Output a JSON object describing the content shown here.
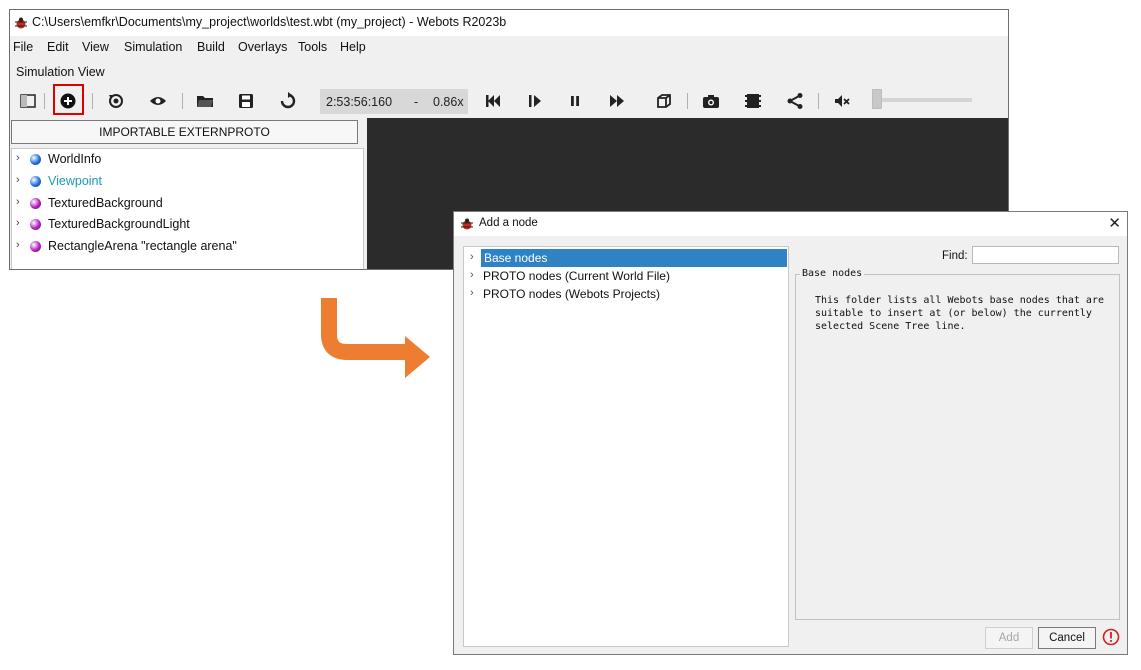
{
  "main_window": {
    "title": "C:\\Users\\emfkr\\Documents\\my_project\\worlds\\test.wbt (my_project) - Webots R2023b",
    "menu": [
      "File",
      "Edit",
      "View",
      "Simulation",
      "Build",
      "Overlays",
      "Tools",
      "Help"
    ],
    "view_label": "Simulation View",
    "toolbar": {
      "icons": [
        "panel-toggle-icon",
        "add-node-icon",
        "reset-view-icon",
        "eye-icon",
        "open-folder-icon",
        "save-icon",
        "reload-icon",
        "step-back-icon",
        "step-forward-icon",
        "pause-icon",
        "fast-forward-icon",
        "cube-icon",
        "camera-icon",
        "film-icon",
        "share-icon",
        "mute-icon"
      ],
      "time": "2:53:56:160",
      "dash": "-",
      "speed": "0.86x"
    },
    "extern_button": "IMPORTABLE EXTERNPROTO",
    "scene_tree": [
      {
        "label": "WorldInfo",
        "color": "#1f6fe0",
        "text_color": "#111111"
      },
      {
        "label": "Viewpoint",
        "color": "#1f6fe0",
        "text_color": "#1a9bb5"
      },
      {
        "label": "TexturedBackground",
        "color": "#b21fbf",
        "text_color": "#111111"
      },
      {
        "label": "TexturedBackgroundLight",
        "color": "#b21fbf",
        "text_color": "#111111"
      },
      {
        "label": "RectangleArena \"rectangle arena\"",
        "color": "#b21fbf",
        "text_color": "#111111"
      }
    ],
    "highlight_color": "#e10000"
  },
  "arrow_color": "#ed7d31",
  "dialog": {
    "title": "Add a node",
    "close": "✕",
    "tree": [
      {
        "label": "Base nodes",
        "selected": true
      },
      {
        "label": "PROTO nodes (Current World File)",
        "selected": false
      },
      {
        "label": "PROTO nodes (Webots Projects)",
        "selected": false
      }
    ],
    "find_label": "Find:",
    "find_value": "",
    "group_title": "Base nodes",
    "description": "This folder lists all Webots base nodes that are suitable to insert at (or below) the currently selected Scene Tree line.",
    "add_label": "Add",
    "cancel_label": "Cancel",
    "selection_color": "#2f83c4"
  }
}
